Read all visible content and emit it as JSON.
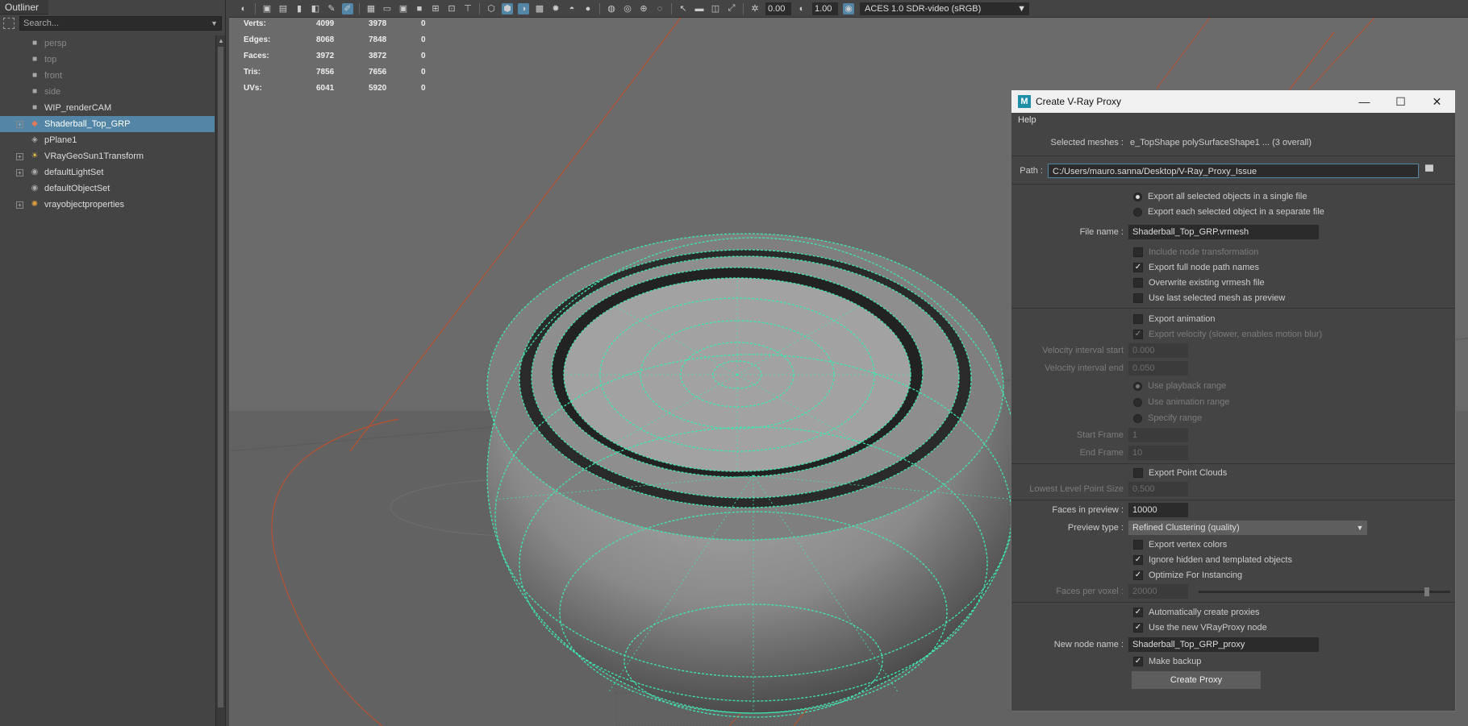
{
  "outliner": {
    "title": "Outliner",
    "search_placeholder": "Search...",
    "items": [
      {
        "label": "persp",
        "icon": "camera-icon"
      },
      {
        "label": "top",
        "icon": "camera-icon"
      },
      {
        "label": "front",
        "icon": "camera-icon"
      },
      {
        "label": "side",
        "icon": "camera-icon"
      },
      {
        "label": "WIP_renderCAM",
        "icon": "camera-icon"
      },
      {
        "label": "Shaderball_Top_GRP",
        "icon": "group-icon"
      },
      {
        "label": "pPlane1",
        "icon": "mesh-icon"
      },
      {
        "label": "VRayGeoSun1Transform",
        "icon": "sun-icon"
      },
      {
        "label": "defaultLightSet",
        "icon": "set-icon"
      },
      {
        "label": "defaultObjectSet",
        "icon": "set-icon"
      },
      {
        "label": "vrayobjectproperties",
        "icon": "properties-icon"
      }
    ]
  },
  "toolbar": {
    "exposure": "0.00",
    "gamma": "1.00",
    "color_management": "ACES 1.0 SDR-video (sRGB)"
  },
  "stats": [
    {
      "label": "Verts:",
      "a": "4099",
      "b": "3978",
      "c": "0"
    },
    {
      "label": "Edges:",
      "a": "8068",
      "b": "7848",
      "c": "0"
    },
    {
      "label": "Faces:",
      "a": "3972",
      "b": "3872",
      "c": "0"
    },
    {
      "label": "Tris:",
      "a": "7856",
      "b": "7656",
      "c": "0"
    },
    {
      "label": "UVs:",
      "a": "6041",
      "b": "5920",
      "c": "0"
    }
  ],
  "dialog": {
    "title": "Create V-Ray Proxy",
    "menu_help": "Help",
    "selected_meshes_label": "Selected meshes :",
    "selected_meshes_value": "e_TopShape polySurfaceShape1  ... (3 overall)",
    "path_label": "Path :",
    "path_value": "C:/Users/mauro.sanna/Desktop/V-Ray_Proxy_Issue",
    "export_single": "Export all selected objects in a single file",
    "export_separate": "Export each selected object in a separate file",
    "file_name_label": "File name :",
    "file_name_value": "Shaderball_Top_GRP.vrmesh",
    "include_node_transformation": "Include node transformation",
    "export_full_node_path": "Export full node path names",
    "overwrite_existing": "Overwrite existing vrmesh file",
    "use_last_selected": "Use last selected mesh as preview",
    "export_animation": "Export animation",
    "export_velocity": "Export velocity (slower, enables motion blur)",
    "velocity_start_label": "Velocity interval start",
    "velocity_start_value": "0.000",
    "velocity_end_label": "Velocity interval end",
    "velocity_end_value": "0.050",
    "use_playback_range": "Use playback range",
    "use_animation_range": "Use animation range",
    "specify_range": "Specify range",
    "start_frame_label": "Start Frame",
    "start_frame_value": "1",
    "end_frame_label": "End Frame",
    "end_frame_value": "10",
    "export_point_clouds": "Export Point Clouds",
    "lowest_level_label": "Lowest Level Point Size",
    "lowest_level_value": "0.500",
    "faces_preview_label": "Faces in preview :",
    "faces_preview_value": "10000",
    "preview_type_label": "Preview type :",
    "preview_type_value": "Refined Clustering (quality)",
    "export_vertex_colors": "Export vertex colors",
    "ignore_hidden": "Ignore hidden and templated objects",
    "optimize_instancing": "Optimize For Instancing",
    "faces_per_voxel_label": "Faces per voxel :",
    "faces_per_voxel_value": "20000",
    "auto_create_proxies": "Automatically create proxies",
    "use_new_vrayproxy": "Use the new VRayProxy node",
    "new_node_name_label": "New node name :",
    "new_node_name_value": "Shaderball_Top_GRP_proxy",
    "make_backup": "Make backup",
    "create_proxy_button": "Create Proxy",
    "accent": "#5285a6",
    "wire_color": "#3ee8b4"
  }
}
